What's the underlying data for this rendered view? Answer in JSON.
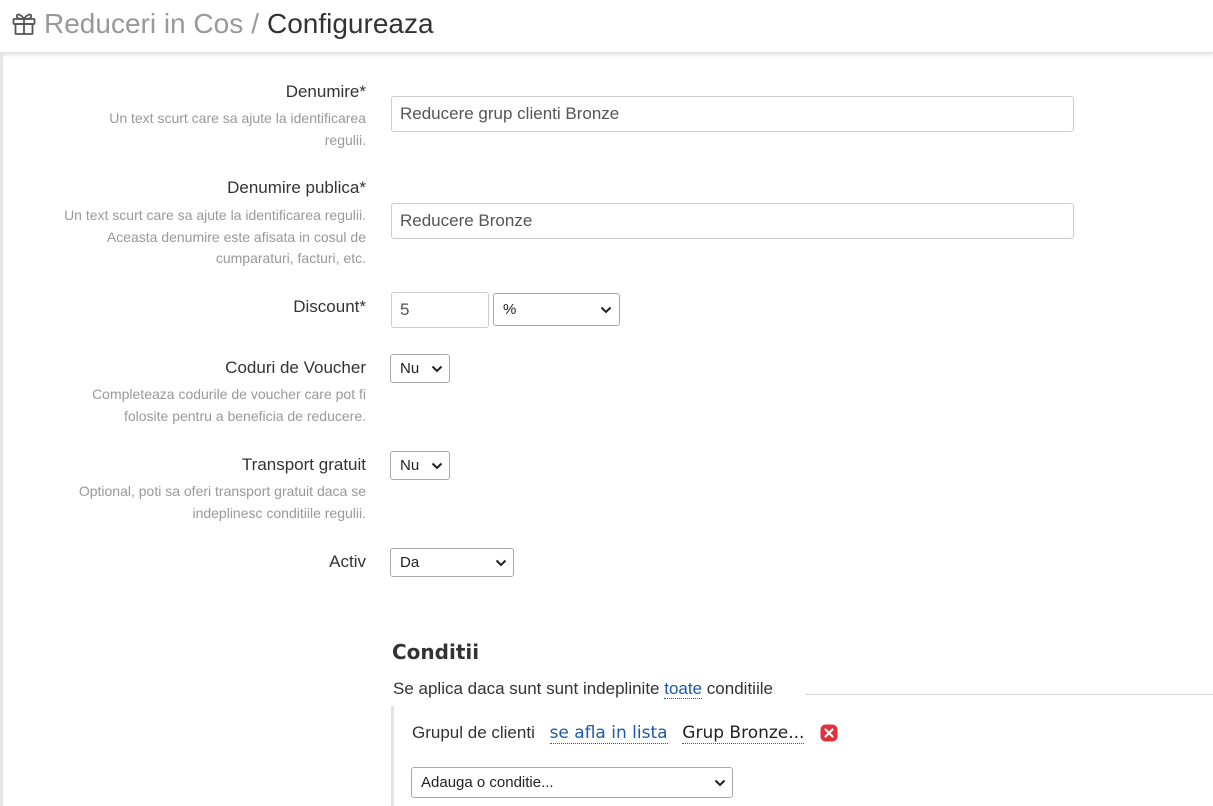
{
  "header": {
    "parent": "Reduceri in Cos",
    "separator": "/",
    "current": "Configureaza",
    "icon": "gift-icon"
  },
  "form": {
    "name": {
      "label": "Denumire*",
      "help": "Un text scurt care sa ajute la identificarea regulii.",
      "value": "Reducere grup clienti Bronze"
    },
    "public_name": {
      "label": "Denumire publica*",
      "help": "Un text scurt care sa ajute la identificarea regulii. Aceasta denumire este afisata in cosul de cumparaturi, facturi, etc.",
      "value": "Reducere Bronze"
    },
    "discount": {
      "label": "Discount*",
      "value": "5",
      "unit": "%"
    },
    "voucher": {
      "label": "Coduri de Voucher",
      "help": "Completeaza codurile de voucher care pot fi folosite pentru a beneficia de reducere.",
      "value": "Nu"
    },
    "free_shipping": {
      "label": "Transport gratuit",
      "help": "Optional, poti sa oferi transport gratuit daca se indeplinesc conditiile regulii.",
      "value": "Nu"
    },
    "active": {
      "label": "Activ",
      "value": "Da"
    }
  },
  "conditions": {
    "title": "Conditii",
    "summary_before": "Se aplica daca sunt sunt indeplinite",
    "summary_link": "toate",
    "summary_after": "conditiile",
    "rows": [
      {
        "field": "Grupul de clienti",
        "operator": "se afla in lista",
        "value": "Grup Bronze..."
      }
    ],
    "add_placeholder": "Adauga o conditie..."
  },
  "colors": {
    "link": "#1a5aa6",
    "remove": "#e0303a",
    "muted": "#999999"
  }
}
